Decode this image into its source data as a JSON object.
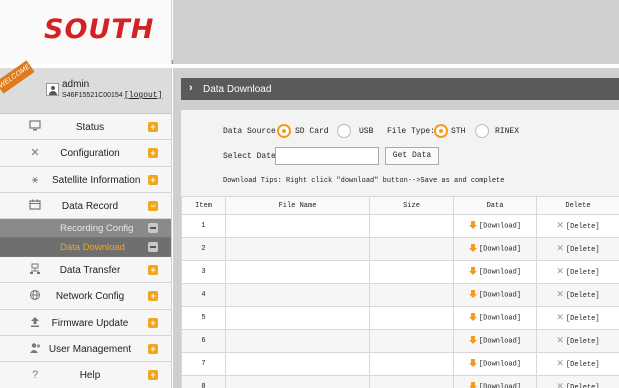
{
  "header": {
    "logo": "SOUTH"
  },
  "user": {
    "welcome": "WELCOME",
    "name": "admin",
    "serial": "S46F15521C00154",
    "logout": "[logout]"
  },
  "sidebar": {
    "items": [
      {
        "label": "Status",
        "icon": "monitor-icon"
      },
      {
        "label": "Configuration",
        "icon": "tools-icon"
      },
      {
        "label": "Satellite Information",
        "icon": "satellite-icon"
      },
      {
        "label": "Data Record",
        "icon": "calendar-icon",
        "expanded": true
      },
      {
        "label": "Data Transfer",
        "icon": "network-icon"
      },
      {
        "label": "Network Config",
        "icon": "globe-icon"
      },
      {
        "label": "Firmware Update",
        "icon": "upload-icon"
      },
      {
        "label": "User Management",
        "icon": "users-icon"
      },
      {
        "label": "Help",
        "icon": "question-icon"
      }
    ],
    "subitems": [
      {
        "label": "Recording Config",
        "active": false
      },
      {
        "label": "Data Download",
        "active": true
      }
    ]
  },
  "page": {
    "title": "Data Download",
    "data_source_label": "Data Source:",
    "data_source_options": [
      "SD Card",
      "USB"
    ],
    "data_source_selected": "SD Card",
    "file_type_label": "File Type:",
    "file_type_options": [
      "STH",
      "RINEX"
    ],
    "file_type_selected": "STH",
    "select_date_label": "Select Date:",
    "select_date_value": "",
    "get_data_button": "Get Data",
    "tips": "Download Tips: Right click \"download\" button-->Save as and complete"
  },
  "table": {
    "columns": [
      "Item",
      "File Name",
      "Size",
      "Data",
      "Delete"
    ],
    "download_label": "[Download]",
    "delete_label": "[Delete]",
    "rows": [
      {
        "item": "1",
        "file_name": "",
        "size": ""
      },
      {
        "item": "2",
        "file_name": "",
        "size": ""
      },
      {
        "item": "3",
        "file_name": "",
        "size": ""
      },
      {
        "item": "4",
        "file_name": "",
        "size": ""
      },
      {
        "item": "5",
        "file_name": "",
        "size": ""
      },
      {
        "item": "6",
        "file_name": "",
        "size": ""
      },
      {
        "item": "7",
        "file_name": "",
        "size": ""
      },
      {
        "item": "8",
        "file_name": "",
        "size": ""
      }
    ]
  },
  "colors": {
    "accent": "#f39b1c",
    "brand": "#d42222",
    "title_bar": "#5a5a5a"
  }
}
